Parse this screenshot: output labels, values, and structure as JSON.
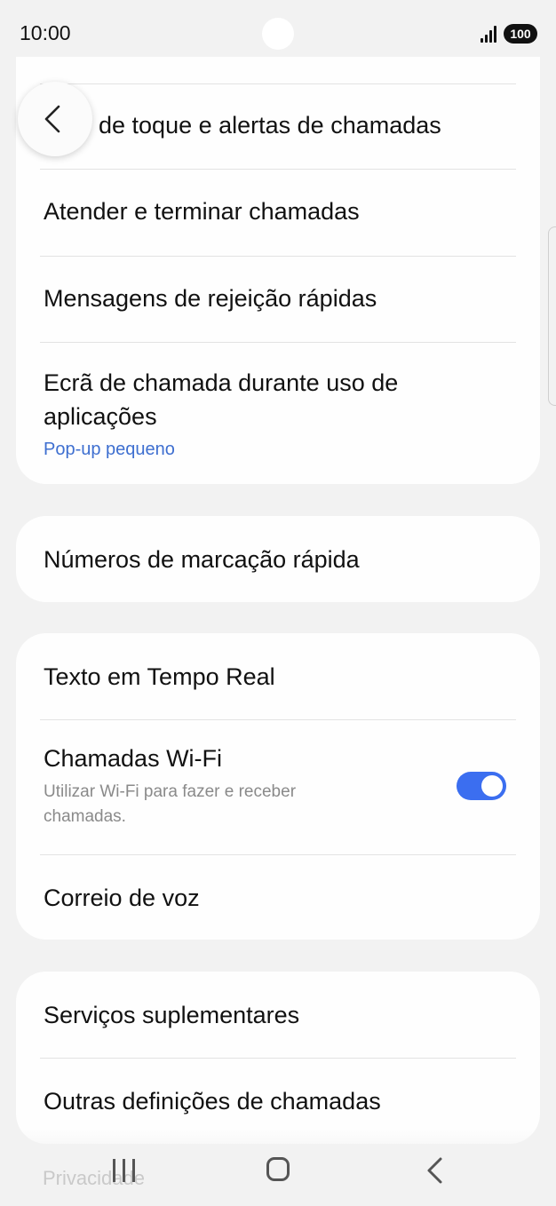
{
  "status_bar": {
    "time": "10:00",
    "battery": "100"
  },
  "card1": {
    "items": [
      {
        "label": "Toque de toque e alertas de chamadas",
        "visible_text": "de toque e alertas de chamadas"
      },
      {
        "label": "Atender e terminar chamadas"
      },
      {
        "label": "Mensagens de rejeição rápidas"
      },
      {
        "label_line1": "Ecrã de chamada durante uso de",
        "label_line2": "aplicações",
        "value": "Pop-up pequeno"
      }
    ]
  },
  "card2": {
    "items": [
      {
        "label": "Números de marcação rápida"
      }
    ]
  },
  "card3": {
    "items": [
      {
        "label": "Texto em Tempo Real"
      },
      {
        "label": "Chamadas Wi-Fi",
        "sub_line1": "Utilizar Wi-Fi para fazer e receber",
        "sub_line2": "chamadas.",
        "toggle": "on"
      },
      {
        "label": "Correio de voz"
      }
    ]
  },
  "card4": {
    "items": [
      {
        "label": "Serviços suplementares"
      },
      {
        "label": "Outras definições de chamadas"
      }
    ]
  },
  "ghost_item": "Privacidade",
  "colors": {
    "accent": "#3b6ef0",
    "link": "#3e6fd0",
    "background": "#f2f2f2",
    "card": "#fefefe"
  },
  "icons": [
    "back-arrow-icon",
    "signal-icon",
    "battery-icon",
    "nav-recents-icon",
    "nav-home-icon",
    "nav-back-icon"
  ]
}
